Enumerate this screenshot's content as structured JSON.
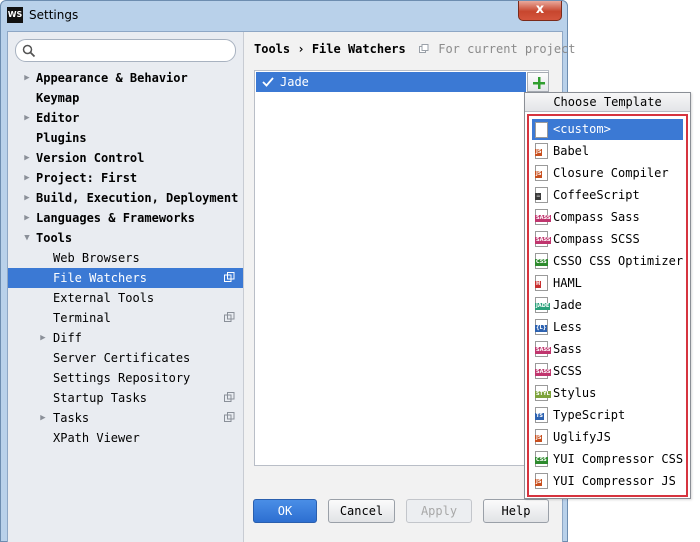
{
  "window": {
    "title": "Settings",
    "app_badge": "WS",
    "close_glyph": "x"
  },
  "search": {
    "value": "",
    "placeholder": ""
  },
  "tree": [
    {
      "label": "Appearance & Behavior",
      "bold": true,
      "arrow": "right",
      "indent": 0
    },
    {
      "label": "Keymap",
      "bold": true,
      "arrow": "none",
      "indent": 0
    },
    {
      "label": "Editor",
      "bold": true,
      "arrow": "right",
      "indent": 0
    },
    {
      "label": "Plugins",
      "bold": true,
      "arrow": "none",
      "indent": 0
    },
    {
      "label": "Version Control",
      "bold": true,
      "arrow": "right",
      "indent": 0,
      "project_icon": true
    },
    {
      "label": "Project: First",
      "bold": true,
      "arrow": "right",
      "indent": 0,
      "project_icon": true
    },
    {
      "label": "Build, Execution, Deployment",
      "bold": true,
      "arrow": "right",
      "indent": 0
    },
    {
      "label": "Languages & Frameworks",
      "bold": true,
      "arrow": "right",
      "indent": 0
    },
    {
      "label": "Tools",
      "bold": true,
      "arrow": "down",
      "indent": 0
    },
    {
      "label": "Web Browsers",
      "bold": false,
      "arrow": "none",
      "indent": 1
    },
    {
      "label": "File Watchers",
      "bold": false,
      "arrow": "none",
      "indent": 1,
      "selected": true,
      "project_icon": true
    },
    {
      "label": "External Tools",
      "bold": false,
      "arrow": "none",
      "indent": 1
    },
    {
      "label": "Terminal",
      "bold": false,
      "arrow": "none",
      "indent": 1,
      "project_icon": true
    },
    {
      "label": "Diff",
      "bold": false,
      "arrow": "right",
      "indent": 1
    },
    {
      "label": "Server Certificates",
      "bold": false,
      "arrow": "none",
      "indent": 1
    },
    {
      "label": "Settings Repository",
      "bold": false,
      "arrow": "none",
      "indent": 1
    },
    {
      "label": "Startup Tasks",
      "bold": false,
      "arrow": "none",
      "indent": 1,
      "project_icon": true
    },
    {
      "label": "Tasks",
      "bold": false,
      "arrow": "right",
      "indent": 1,
      "project_icon": true
    },
    {
      "label": "XPath Viewer",
      "bold": false,
      "arrow": "none",
      "indent": 1
    }
  ],
  "breadcrumb": {
    "part1": "Tools",
    "separator": "›",
    "part2": "File Watchers",
    "hint": "For current project"
  },
  "watchers": [
    {
      "label": "Jade",
      "checked": true
    }
  ],
  "popup": {
    "title": "Choose Template",
    "items": [
      {
        "label": "<custom>",
        "icon": "blank-file-icon",
        "tag": "",
        "tag_color": "",
        "selected": true
      },
      {
        "label": "Babel",
        "icon": "js-file-icon",
        "tag": "JS",
        "tag_color": "#c8501f"
      },
      {
        "label": "Closure Compiler",
        "icon": "js-file-icon",
        "tag": "JS",
        "tag_color": "#c8501f"
      },
      {
        "label": "CoffeeScript",
        "icon": "coffee-file-icon",
        "tag": "☕",
        "tag_color": "#3a3a3a"
      },
      {
        "label": "Compass Sass",
        "icon": "sass-file-icon",
        "tag": "SASS",
        "tag_color": "#c0366e"
      },
      {
        "label": "Compass SCSS",
        "icon": "sass-file-icon",
        "tag": "SASS",
        "tag_color": "#c0366e"
      },
      {
        "label": "CSSO CSS Optimizer",
        "icon": "css-file-icon",
        "tag": "CSS",
        "tag_color": "#2e8b2e"
      },
      {
        "label": "HAML",
        "icon": "haml-file-icon",
        "tag": "H",
        "tag_color": "#c83030"
      },
      {
        "label": "Jade",
        "icon": "jade-file-icon",
        "tag": "JADE",
        "tag_color": "#2aa07a"
      },
      {
        "label": "Less",
        "icon": "less-file-icon",
        "tag": "{L}",
        "tag_color": "#2d62b0"
      },
      {
        "label": "Sass",
        "icon": "sass-file-icon",
        "tag": "SASS",
        "tag_color": "#c0366e"
      },
      {
        "label": "SCSS",
        "icon": "sass-file-icon",
        "tag": "SASS",
        "tag_color": "#c0366e"
      },
      {
        "label": "Stylus",
        "icon": "stylus-file-icon",
        "tag": "STYL",
        "tag_color": "#7da33a"
      },
      {
        "label": "TypeScript",
        "icon": "ts-file-icon",
        "tag": "TS",
        "tag_color": "#2d62b0"
      },
      {
        "label": "UglifyJS",
        "icon": "js-file-icon",
        "tag": "JS",
        "tag_color": "#c8501f"
      },
      {
        "label": "YUI Compressor CSS",
        "icon": "css-file-icon",
        "tag": "CSS",
        "tag_color": "#2e8b2e"
      },
      {
        "label": "YUI Compressor JS",
        "icon": "js-file-icon",
        "tag": "JS",
        "tag_color": "#c8501f"
      }
    ]
  },
  "buttons": {
    "ok": "OK",
    "cancel": "Cancel",
    "apply": "Apply",
    "help": "Help"
  },
  "colors": {
    "selection": "#3b79d4",
    "popup_highlight_border": "#d6343f",
    "add_icon": "#2f9e2f"
  }
}
